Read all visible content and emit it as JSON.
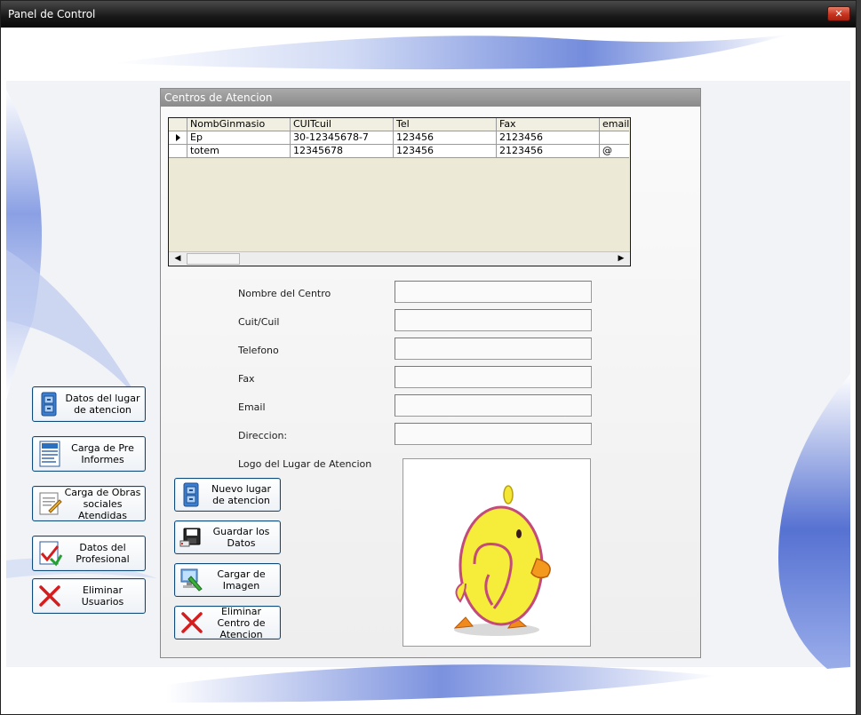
{
  "window": {
    "title": "Panel de Control",
    "close_glyph": "✕"
  },
  "groupbox": {
    "title": "Centros de Atencion"
  },
  "grid": {
    "columns": [
      "NombGinmasio",
      "CUITcuil",
      "Tel",
      "Fax",
      "email"
    ],
    "rows": [
      [
        "Ep",
        "30-12345678-7",
        "123456",
        "2123456",
        ""
      ],
      [
        "totem",
        "12345678",
        "123456",
        "2123456",
        "@"
      ]
    ],
    "scroll_left": "◀",
    "scroll_right": "▶"
  },
  "form": {
    "nombre_label": "Nombre del Centro",
    "cuit_label": "Cuit/Cuil",
    "telefono_label": "Telefono",
    "fax_label": "Fax",
    "email_label": "Email",
    "direccion_label": "Direccion:",
    "logo_label": "Logo del Lugar de Atencion",
    "nombre_value": "",
    "cuit_value": "",
    "telefono_value": "",
    "fax_value": "",
    "email_value": "",
    "direccion_value": ""
  },
  "actions": {
    "nuevo": "Nuevo lugar de atencion",
    "guardar": "Guardar los Datos",
    "cargar": "Cargar de Imagen",
    "eliminar": "Eliminar Centro de Atencion"
  },
  "sidebar": {
    "items": [
      {
        "label": "Datos del lugar de atencion",
        "icon": "cabinet-icon"
      },
      {
        "label": "Carga de Pre Informes",
        "icon": "document-icon"
      },
      {
        "label": "Carga de Obras sociales Atendidas",
        "icon": "edit-document-icon"
      },
      {
        "label": "Datos del Profesional",
        "icon": "checkmark-document-icon"
      },
      {
        "label": "Eliminar Usuarios",
        "icon": "delete-x-icon"
      }
    ]
  }
}
